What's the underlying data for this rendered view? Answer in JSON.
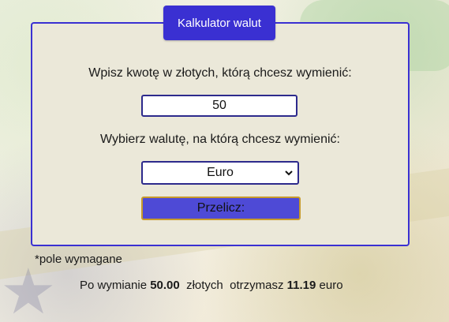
{
  "calculator": {
    "title": "Kalkulator walut",
    "amount_label": "Wpisz kwotę w złotych, którą chcesz wymienić:",
    "amount_value": "50",
    "currency_label": "Wybierz walutę, na którą chcesz wymienić:",
    "currency_selected": "Euro",
    "submit_label": "Przelicz:"
  },
  "required_note": "*pole wymagane",
  "result": {
    "prefix": "Po wymianie ",
    "amount": "50.00",
    "middle": "  złotych  otrzymasz ",
    "converted": "11.19",
    "suffix": " euro"
  },
  "colors": {
    "accent": "#3a30d2",
    "panel_bg": "#ebe8d9",
    "button_bg": "#4e4ad6",
    "button_border": "#c79a2c"
  },
  "icons": {
    "select_arrow": "chevron-down-icon"
  }
}
